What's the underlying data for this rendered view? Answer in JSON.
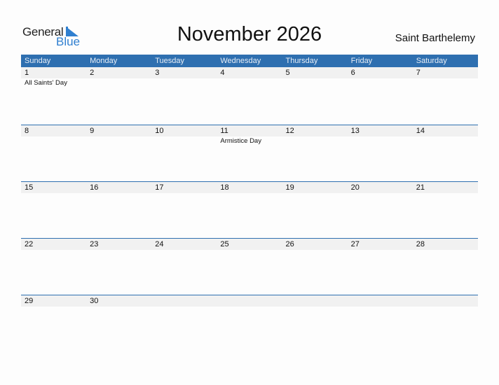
{
  "logo": {
    "word1": "General",
    "word2": "Blue",
    "accent": "#2f7fd0"
  },
  "title": "November 2026",
  "country": "Saint Barthelemy",
  "colors": {
    "header_bg": "#2e6fb0",
    "day_band": "#f1f1f1"
  },
  "weekdays": [
    "Sunday",
    "Monday",
    "Tuesday",
    "Wednesday",
    "Thursday",
    "Friday",
    "Saturday"
  ],
  "weeks": [
    {
      "days": [
        "1",
        "2",
        "3",
        "4",
        "5",
        "6",
        "7"
      ],
      "holidays": [
        "All Saints' Day",
        "",
        "",
        "",
        "",
        "",
        ""
      ]
    },
    {
      "days": [
        "8",
        "9",
        "10",
        "11",
        "12",
        "13",
        "14"
      ],
      "holidays": [
        "",
        "",
        "",
        "Armistice Day",
        "",
        "",
        ""
      ]
    },
    {
      "days": [
        "15",
        "16",
        "17",
        "18",
        "19",
        "20",
        "21"
      ],
      "holidays": [
        "",
        "",
        "",
        "",
        "",
        "",
        ""
      ]
    },
    {
      "days": [
        "22",
        "23",
        "24",
        "25",
        "26",
        "27",
        "28"
      ],
      "holidays": [
        "",
        "",
        "",
        "",
        "",
        "",
        ""
      ]
    },
    {
      "days": [
        "29",
        "30",
        "",
        "",
        "",
        "",
        ""
      ],
      "holidays": [
        "",
        "",
        "",
        "",
        "",
        "",
        ""
      ]
    }
  ]
}
